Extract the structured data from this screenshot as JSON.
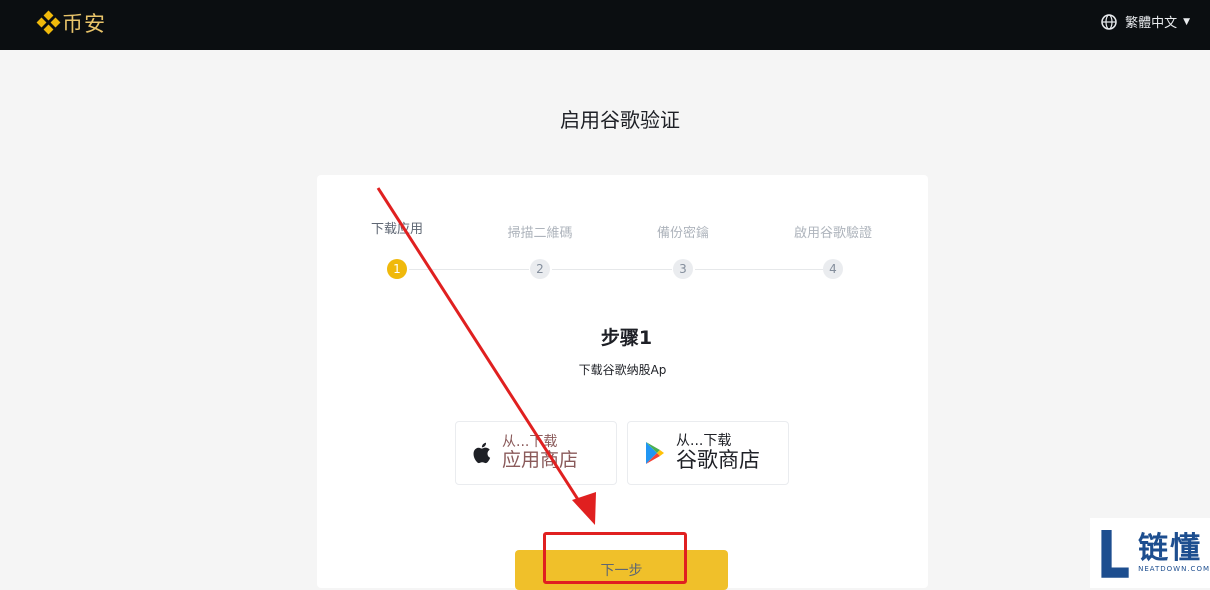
{
  "header": {
    "logo_text": "币安",
    "language": "繁體中文",
    "accent_color": "#f0b90b"
  },
  "page": {
    "title": "启用谷歌验证"
  },
  "steps": [
    {
      "label": "下载应用",
      "number": "1",
      "active": true
    },
    {
      "label": "掃描二維碼",
      "number": "2",
      "active": false
    },
    {
      "label": "備份密鑰",
      "number": "3",
      "active": false
    },
    {
      "label": "啟用谷歌驗證",
      "number": "4",
      "active": false
    }
  ],
  "content": {
    "step_title": "步骤1",
    "step_desc": "下载谷歌纳股Ap"
  },
  "stores": {
    "apple": {
      "line1": "从...下载",
      "line2": "应用商店",
      "icon": "apple-icon"
    },
    "google": {
      "line1": "从...下载",
      "line2": "谷歌商店",
      "icon": "google-play-icon"
    }
  },
  "actions": {
    "next_label": "下一步"
  },
  "watermark": {
    "main": "链懂",
    "sub": "NEATDOWN.COM"
  }
}
